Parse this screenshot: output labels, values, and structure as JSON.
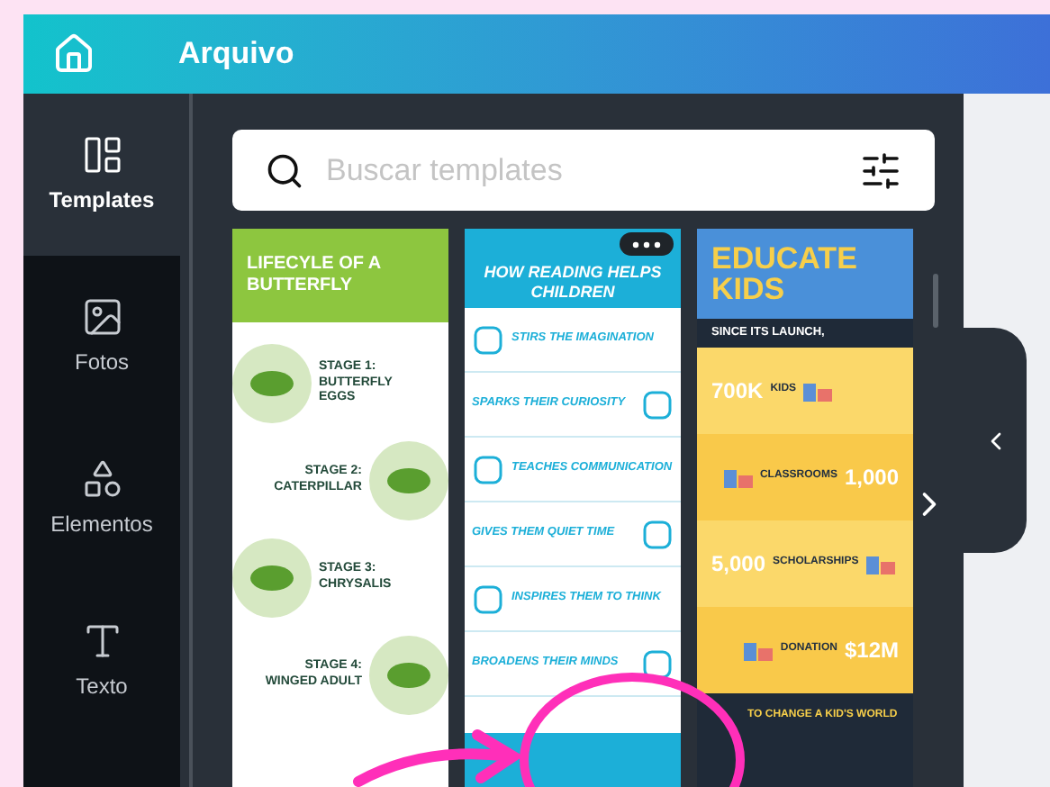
{
  "header": {
    "title": "Arquivo"
  },
  "sidebar": {
    "items": [
      {
        "label": "Templates",
        "selected": true
      },
      {
        "label": "Fotos",
        "selected": false
      },
      {
        "label": "Elementos",
        "selected": false
      },
      {
        "label": "Texto",
        "selected": false
      }
    ]
  },
  "search": {
    "placeholder": "Buscar templates"
  },
  "templates": [
    {
      "kind": "butterfly",
      "title": "LIFECYLE OF A BUTTERFLY",
      "stages": [
        "STAGE 1: BUTTERFLY EGGS",
        "STAGE 2: CATERPILLAR",
        "STAGE 3: CHRYSALIS",
        "STAGE 4: WINGED ADULT"
      ]
    },
    {
      "kind": "reading",
      "title": "HOW READING HELPS CHILDREN",
      "sections": [
        "STIRS THE IMAGINATION",
        "SPARKS THEIR CURIOSITY",
        "TEACHES COMMUNICATION",
        "GIVES THEM QUIET TIME",
        "INSPIRES THEM TO THINK",
        "BROADENS THEIR MINDS"
      ]
    },
    {
      "kind": "educate",
      "title": "EDUCATE KIDS",
      "subtitle": "SINCE ITS LAUNCH,",
      "stats": [
        {
          "value": "700K",
          "label": "KIDS"
        },
        {
          "value": "1,000",
          "label": "CLASSROOMS"
        },
        {
          "value": "5,000",
          "label": "SCHOLARSHIPS"
        },
        {
          "value": "$12M",
          "label": "DONATION"
        }
      ],
      "footer": "TO CHANGE A KID'S WORLD"
    }
  ]
}
